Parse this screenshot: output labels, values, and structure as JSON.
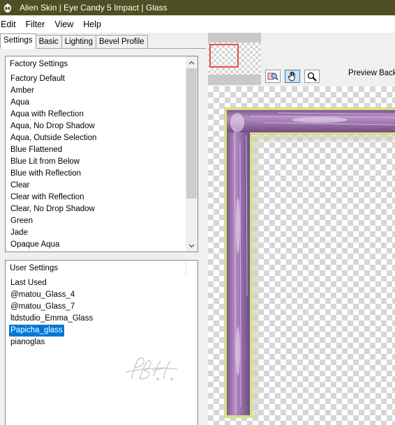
{
  "window": {
    "title": "Alien Skin | Eye Candy 5 Impact | Glass"
  },
  "menu": [
    "Edit",
    "Filter",
    "View",
    "Help"
  ],
  "tabs": [
    "Settings",
    "Basic",
    "Lighting",
    "Bevel Profile"
  ],
  "active_tab": "Settings",
  "factory_settings": {
    "header": "Factory Settings",
    "items": [
      "Factory Default",
      "Amber",
      "Aqua",
      "Aqua with Reflection",
      "Aqua, No Drop Shadow",
      "Aqua, Outside Selection",
      "Blue Flattened",
      "Blue Lit from Below",
      "Blue with Reflection",
      "Clear",
      "Clear with Reflection",
      "Clear, No Drop Shadow",
      "Green",
      "Jade",
      "Opaque Aqua"
    ]
  },
  "user_settings": {
    "header": "User Settings",
    "items": [
      "Last Used",
      "@matou_Glass_4",
      "@matou_Glass_7",
      "ltdstudio_Emma_Glass",
      "Papicha_glass",
      "pianoglas"
    ],
    "selected": "Papicha_glass"
  },
  "preview": {
    "label": "Preview Backc",
    "tools": [
      "preview-toggle-icon",
      "hand-icon",
      "zoom-icon"
    ]
  },
  "colors": {
    "titlebar": "#4f4f22",
    "selection": "#0078d7",
    "frame_purple": "#9a6fa8",
    "frame_outline": "#d4e08a"
  }
}
